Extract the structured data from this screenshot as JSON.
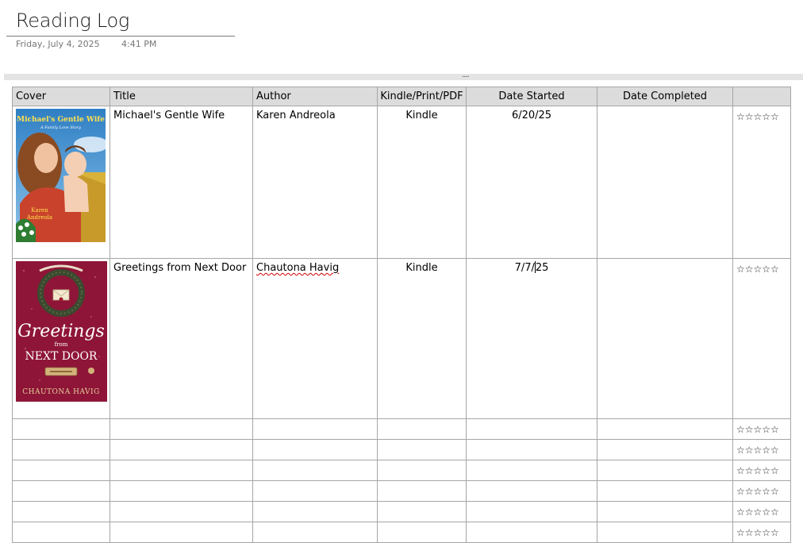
{
  "page": {
    "title": "Reading Log",
    "date": "Friday, July 4, 2025",
    "time": "4:41 PM"
  },
  "container": {
    "handle": "...."
  },
  "table": {
    "headers": {
      "cover": "Cover",
      "title": "Title",
      "author": "Author",
      "format": "Kindle/Print/PDF",
      "date_started": "Date Started",
      "date_completed": "Date Completed",
      "rating": ""
    },
    "rows": [
      {
        "cover": {
          "title": "Michael's Gentle Wife",
          "subtitle": "A Family Love Story",
          "author_line1": "Karen",
          "author_line2": "Andreola"
        },
        "title": "Michael's Gentle Wife",
        "author": "Karen Andreola",
        "format": "Kindle",
        "date_started": "6/20/25",
        "date_completed": "",
        "rating": "☆☆☆☆☆"
      },
      {
        "cover": {
          "title_line1": "Greetings",
          "title_line2": "from",
          "title_line3": "NEXT DOOR",
          "author": "CHAUTONA HAVIG"
        },
        "title": "Greetings from Next Door",
        "author": "Chautona Havig",
        "format": "Kindle",
        "date_started_a": "7/7/",
        "date_started_b": "25",
        "date_completed": "",
        "rating": "☆☆☆☆☆"
      }
    ],
    "empty_rating": "☆☆☆☆☆"
  },
  "colors": {
    "header_bg": "#dcdcdc",
    "border": "#a6a6a6",
    "spellcheck": "#d00000"
  }
}
